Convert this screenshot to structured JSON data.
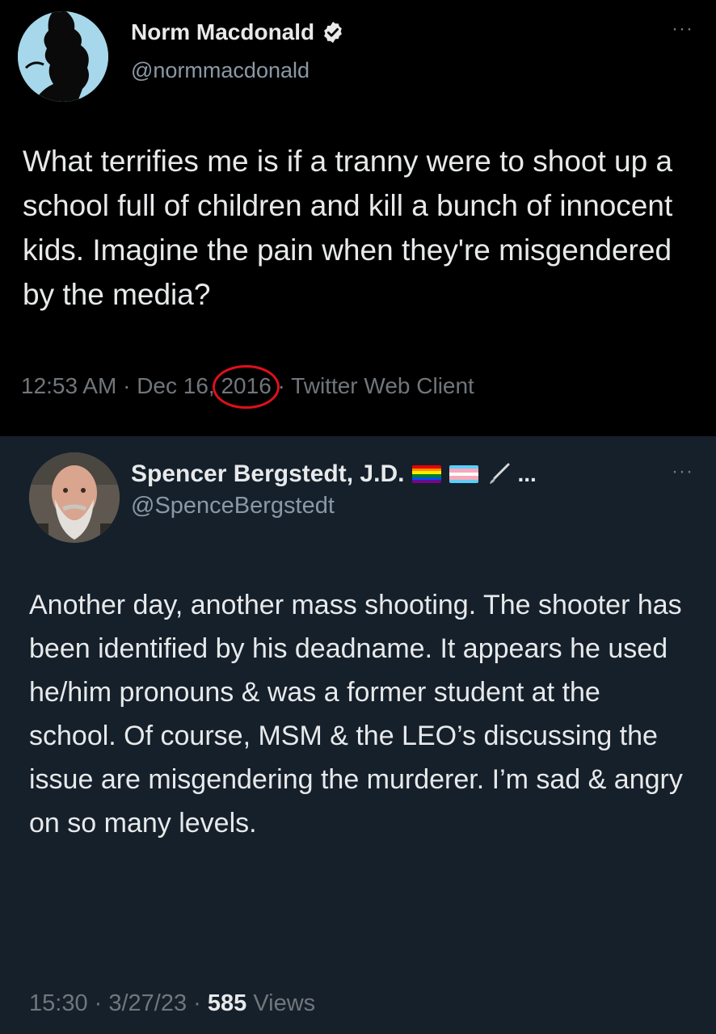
{
  "tweet1": {
    "name": "Norm Macdonald",
    "handle": "@normmacdonald",
    "more": "···",
    "text": "What terrifies me is if a tranny were to shoot up a school full of children and kill a bunch of innocent kids. Imagine the pain when they're misgendered by the media?",
    "time": "12:53 AM",
    "sep": " · ",
    "date_prefix": "Dec 16, ",
    "year": "2016",
    "client": "Twitter Web Client",
    "icons": [
      "verified-badge-icon"
    ],
    "colors": {
      "background": "#000000",
      "circle": "#e0101a"
    }
  },
  "tweet2": {
    "name": "Spencer Bergstedt, J.D.",
    "handle": "@SpenceBergstedt",
    "more": "···",
    "name_suffix": "...",
    "text": "Another day, another mass shooting. The shooter has been identified by his deadname. It appears he used he/him pronouns & was a former student at the school. Of course, MSM & the LEO’s discussing the issue are misgendering the murderer. I’m sad & angry on so many levels.",
    "time": "15:30",
    "sep": " · ",
    "date": "3/27/23",
    "views_count": "585",
    "views_label": " Views",
    "icons": [
      "rainbow-flag-icon",
      "transgender-flag-icon",
      "pen-icon"
    ],
    "colors": {
      "background": "#15202b"
    }
  }
}
